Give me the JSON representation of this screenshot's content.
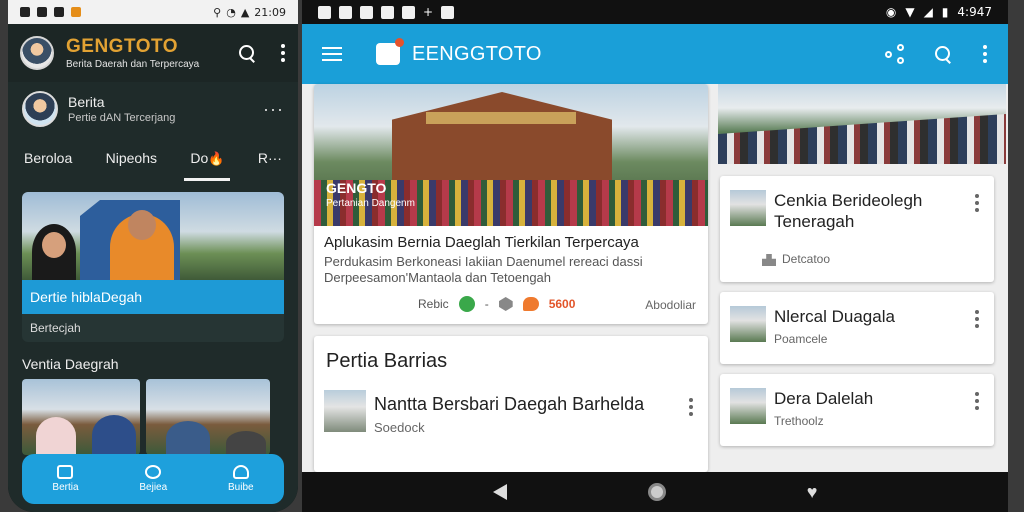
{
  "phone": {
    "status": {
      "time": "21:09"
    },
    "header": {
      "brand": "GENGTOTO",
      "tagline": "Berita Daerah dan Terpercaya"
    },
    "profile": {
      "name": "Berita",
      "subtitle": "Pertie dAN Tercerjang"
    },
    "tabs": [
      {
        "label": "Beroloa"
      },
      {
        "label": "Nipeohs"
      },
      {
        "label": "Do"
      },
      {
        "label": "R···"
      }
    ],
    "feature": {
      "title": "Dertie hiblaDegah",
      "subtitle": "Bertecjah"
    },
    "section_title": "Ventia Daegrah",
    "bottom_nav": [
      {
        "label": "Bertia",
        "icon": "home-icon"
      },
      {
        "label": "Bejiea",
        "icon": "video-icon"
      },
      {
        "label": "Buibe",
        "icon": "people-icon"
      }
    ]
  },
  "tablet": {
    "status": {
      "time": "4:947"
    },
    "appbar": {
      "title": "EENGGTOTO"
    },
    "hero": {
      "brand": "GENGTO",
      "brand_sub": "Pertanian Dangenm",
      "title": "Aplukasim Bernia Daeglah Tierkilan Terpercaya",
      "desc": "Perdukasim Berkoneasi Iakiian Daenumel rereaci dassi Derpeesamon'Mantaola dan Tetoengah",
      "meta_label": "Rebic",
      "meta_count": "5600",
      "source": "Abodoliar"
    },
    "latest": {
      "title": "Pertia Barrias",
      "item": {
        "title": "Nantta Bersbari Daegah Barhelda",
        "source": "Soedock"
      }
    },
    "side": [
      {
        "title": "Cenkia Berideolegh Teneragah",
        "source": "Detcatoo"
      },
      {
        "title": "Nlercal Duagala",
        "source": "Poamcele"
      },
      {
        "title": "Dera Dalelah",
        "source": "Trethoolz"
      }
    ]
  }
}
